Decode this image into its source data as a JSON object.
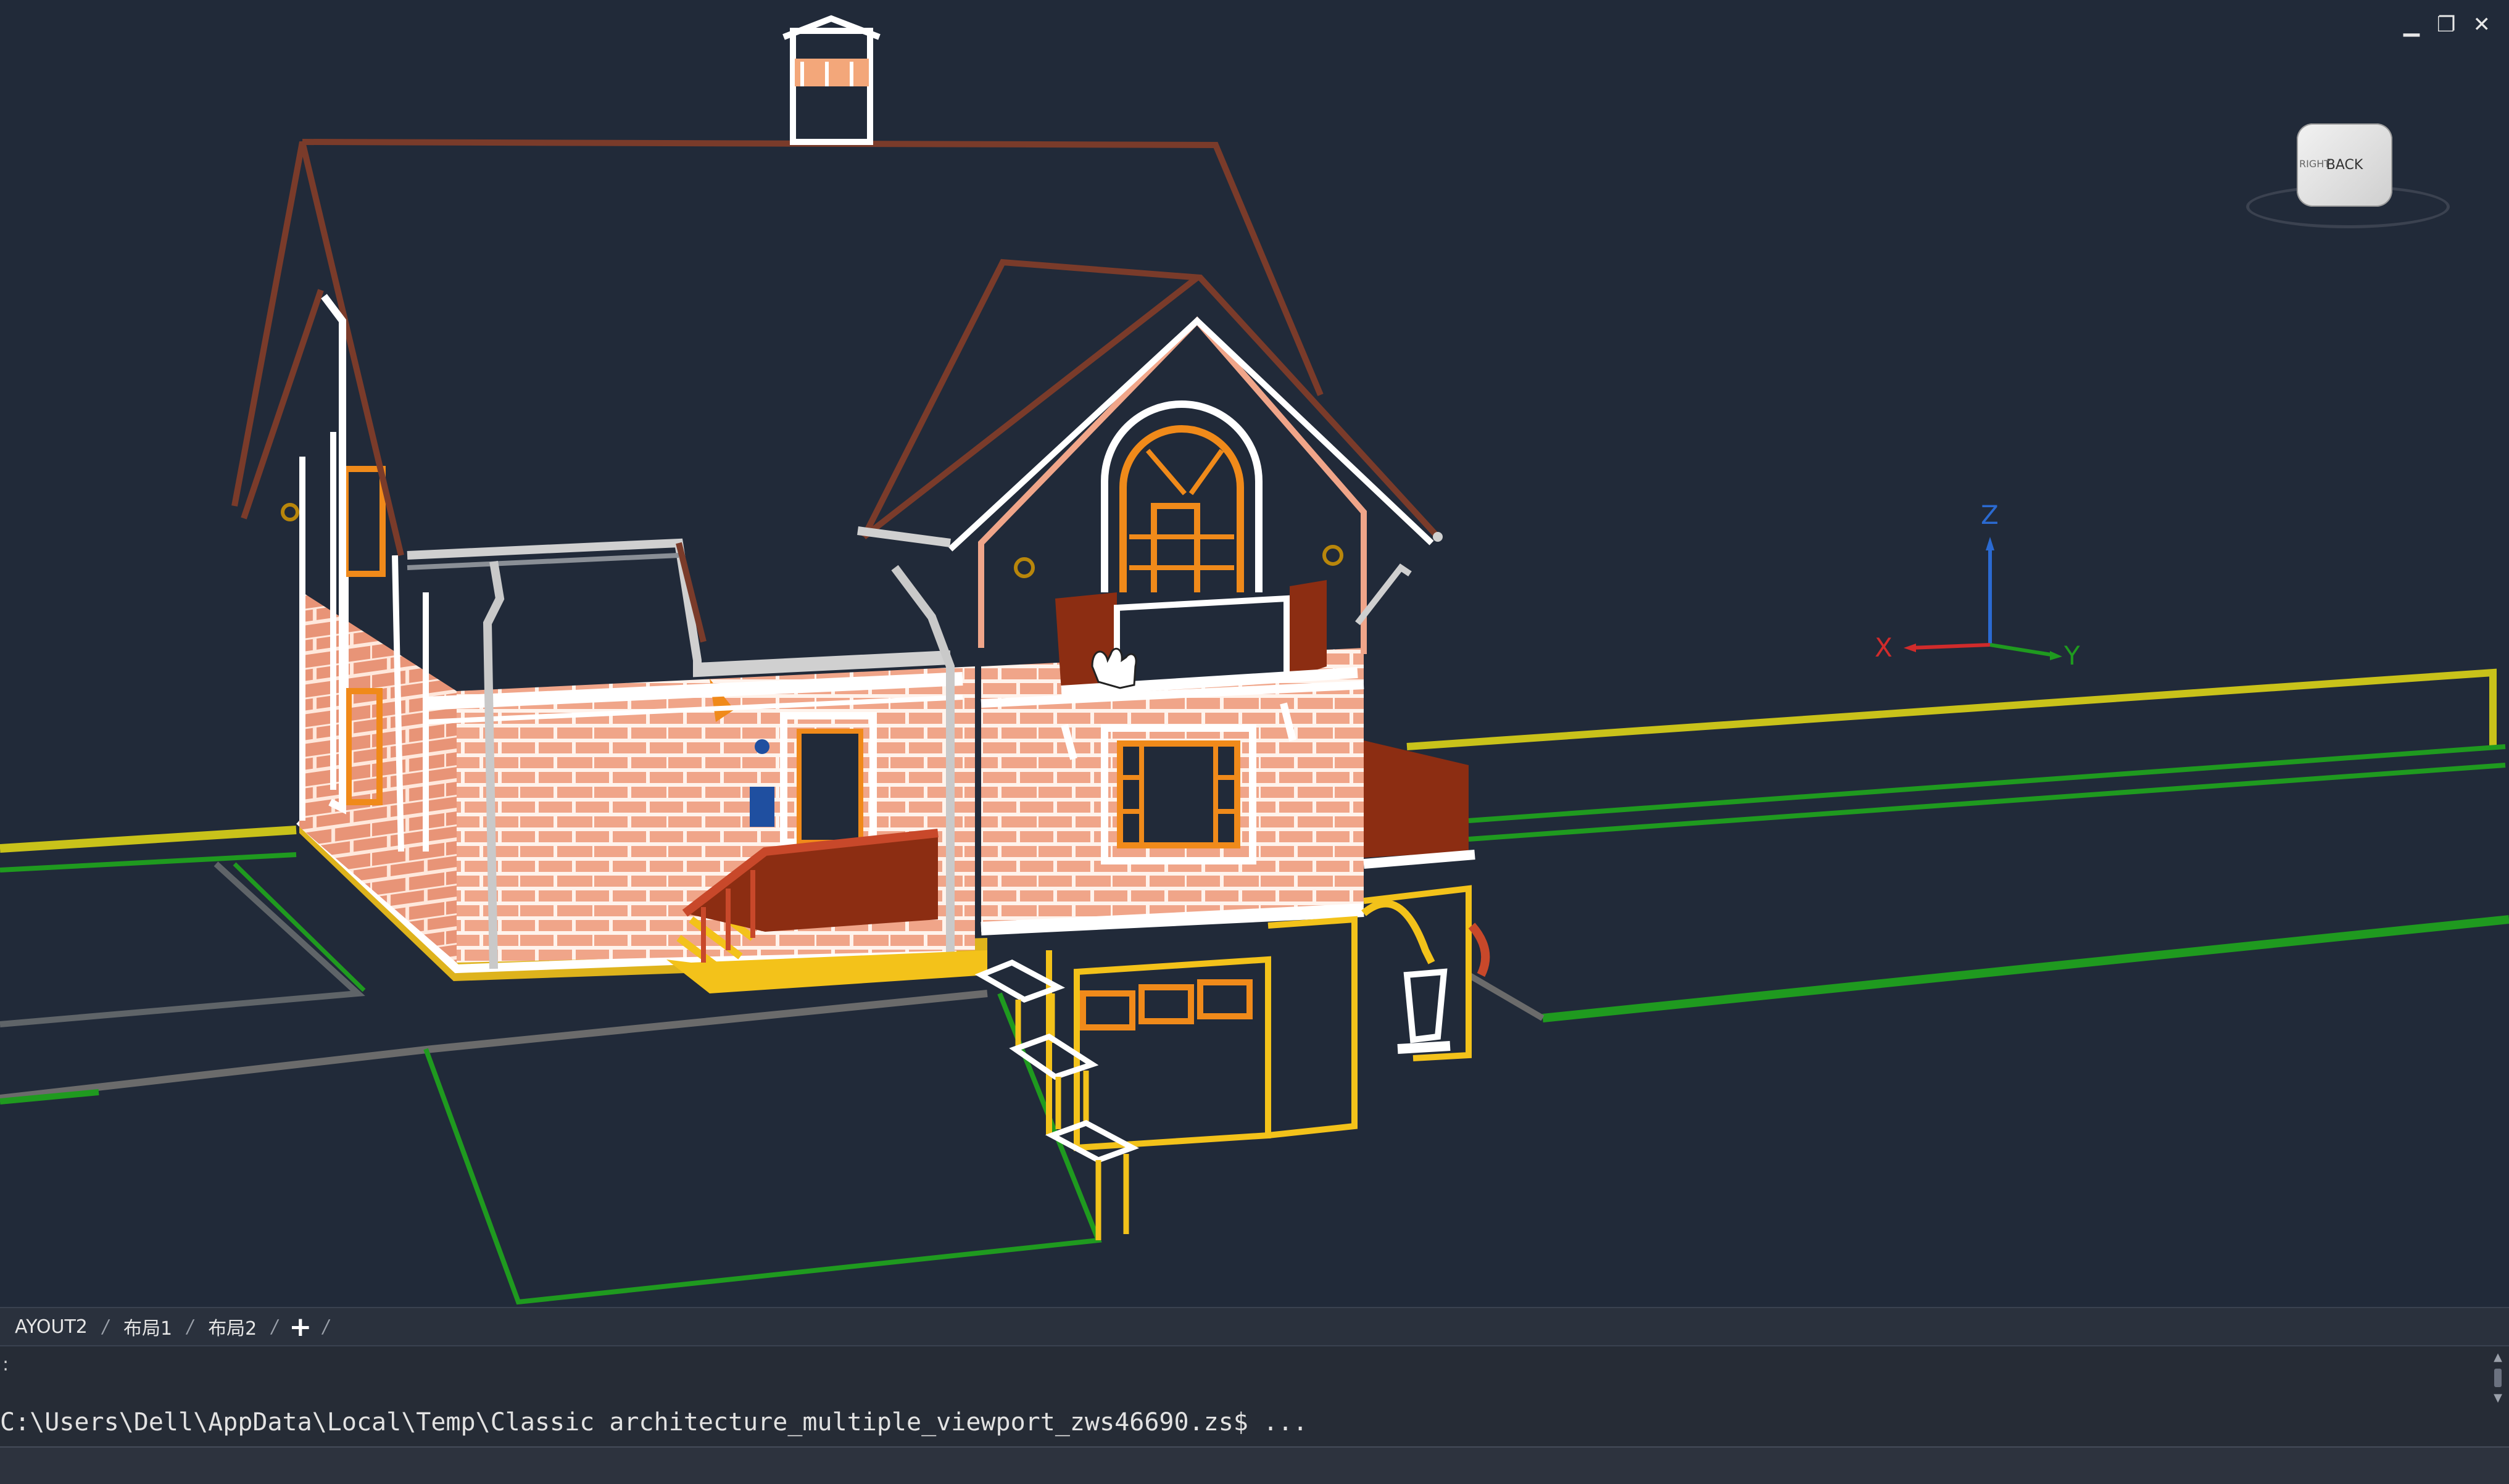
{
  "window": {
    "min_symbol": "▁",
    "restore_symbol": "❐",
    "close_symbol": "✕"
  },
  "viewcube": {
    "face_label": "BACK",
    "side_label": "RIGHT"
  },
  "ucs": {
    "x_label": "X",
    "y_label": "Y",
    "z_label": "Z"
  },
  "layout_tabs": [
    {
      "label": "AYOUT2"
    },
    {
      "label": "布局1"
    },
    {
      "label": "布局2"
    }
  ],
  "tab_add_label": "+",
  "command": {
    "history_marker": ":",
    "line": "C:\\Users\\Dell\\AppData\\Local\\Temp\\Classic architecture_multiple_viewport_zws46690.zs$ ..."
  },
  "colors": {
    "background": "#212a39",
    "brick": "#e9a083",
    "trim": "#ffffff",
    "roof": "#7a3b2a",
    "accent_orange": "#f08a1a",
    "railing": "#8c2d12",
    "ground_green": "#1f9a1f",
    "road_yellow": "#c9c21a",
    "base_yellow": "#f3c21a"
  }
}
